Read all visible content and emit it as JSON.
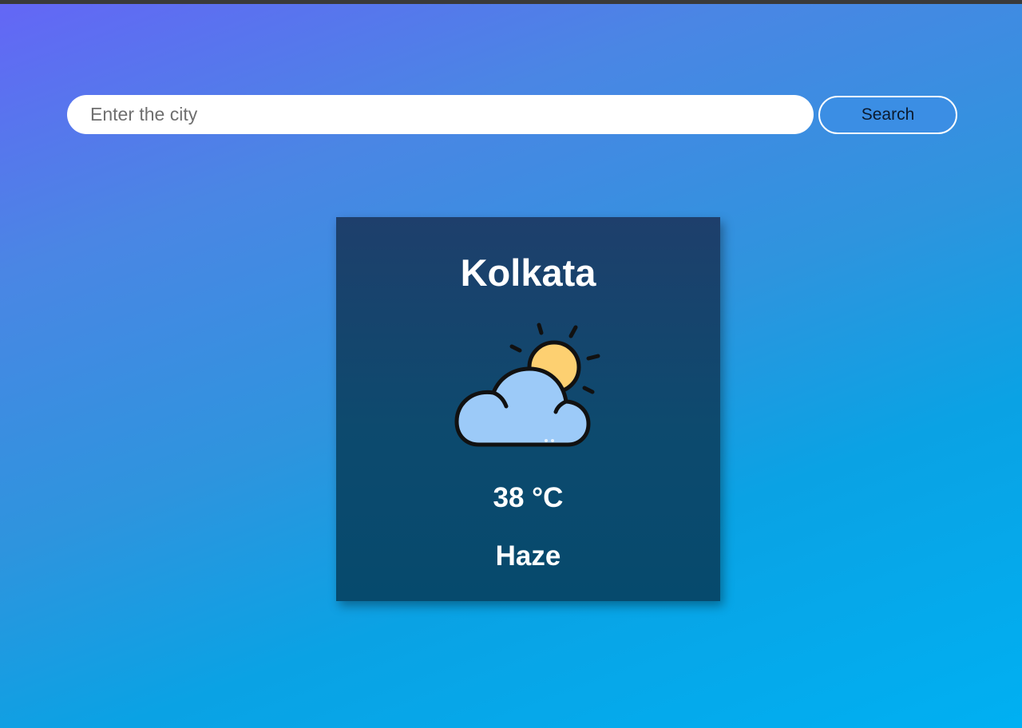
{
  "search": {
    "placeholder": "Enter the city",
    "value": "",
    "button_label": "Search"
  },
  "weather": {
    "city": "Kolkata",
    "icon": "partly-cloudy-icon",
    "temperature": "38 °C",
    "condition": "Haze"
  },
  "colors": {
    "card_background": "#1a4368",
    "sun": "#fdd071",
    "cloud": "#9ccaf8",
    "button": "#3b8ee4"
  }
}
